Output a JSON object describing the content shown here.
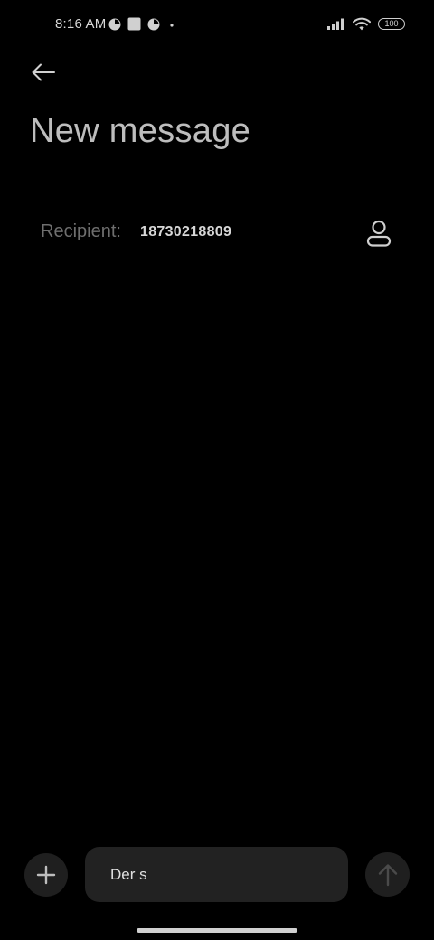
{
  "status_bar": {
    "time": "8:16 AM",
    "battery": "100",
    "left_icons": [
      "pie-clock-icon",
      "square-notification-icon",
      "pie-clock-icon",
      "dot-icon"
    ],
    "right_icons": [
      "signal-icon",
      "wifi-icon",
      "battery-icon"
    ]
  },
  "header": {
    "back_icon": "arrow-left-icon",
    "title": "New message"
  },
  "recipient": {
    "label": "Recipient:",
    "value": "18730218809",
    "contact_icon": "person-icon"
  },
  "composer": {
    "add_icon": "plus-icon",
    "message_text": "Der s",
    "send_icon": "arrow-up-icon"
  },
  "colors": {
    "background": "#000000",
    "surface": "#222222",
    "title_text": "#bdbdbd",
    "label_text": "#6e6e6e"
  }
}
